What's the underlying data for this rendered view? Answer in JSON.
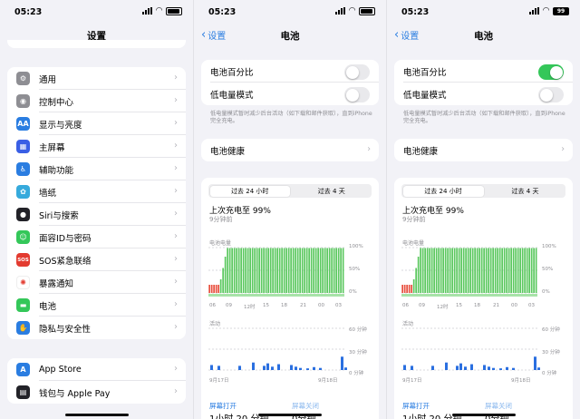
{
  "screens": [
    {
      "time": "05:23",
      "title": "设置",
      "items": [
        {
          "label": "通用",
          "icon": "gear-icon",
          "color": "#8e8e93",
          "glyph": "⚙"
        },
        {
          "label": "控制中心",
          "icon": "control-center-icon",
          "color": "#8e8e93",
          "glyph": "◉"
        },
        {
          "label": "显示与亮度",
          "icon": "display-brightness-icon",
          "color": "#2a7de1",
          "glyph": "AA"
        },
        {
          "label": "主屏幕",
          "icon": "home-screen-icon",
          "color": "#3a5fe5",
          "glyph": "▦"
        },
        {
          "label": "辅助功能",
          "icon": "accessibility-icon",
          "color": "#2a7de1",
          "glyph": "♿"
        },
        {
          "label": "墙纸",
          "icon": "wallpaper-icon",
          "color": "#36aadc",
          "glyph": "✿"
        },
        {
          "label": "Siri与搜索",
          "icon": "siri-icon",
          "color": "#222228",
          "glyph": "●"
        },
        {
          "label": "面容ID与密码",
          "icon": "face-id-icon",
          "color": "#34c759",
          "glyph": "☺"
        },
        {
          "label": "SOS紧急联络",
          "icon": "sos-icon",
          "color": "#e33b30",
          "glyph": "SOS"
        },
        {
          "label": "暴露通知",
          "icon": "exposure-notification-icon",
          "color": "#ffffff",
          "glyph": "✺"
        },
        {
          "label": "电池",
          "icon": "battery-icon",
          "color": "#34c759",
          "glyph": "▬"
        },
        {
          "label": "隐私与安全性",
          "icon": "privacy-hand-icon",
          "color": "#2a7de1",
          "glyph": "✋"
        }
      ],
      "items2": [
        {
          "label": "App Store",
          "icon": "app-store-icon",
          "color": "#2a7de1",
          "glyph": "A"
        },
        {
          "label": "钱包与 Apple Pay",
          "icon": "wallet-icon",
          "color": "#222228",
          "glyph": "▤"
        }
      ]
    },
    {
      "time": "05:23",
      "back": "设置",
      "title": "电池",
      "battery_percentage": "电池百分比",
      "low_power": "低电量模式",
      "percentage_on": false,
      "note": "低电量模式暂时减少后台活动（如下载和邮件获取），直到iPhone完全充电。",
      "battery_health": "电池健康",
      "tab_24h": "过去 24 小时",
      "tab_10d": "过去 4 天",
      "last_charge": "上次充电至 99%",
      "last_charge_ago": "9分钟前",
      "level_label": "电池电量",
      "activity_label": "活动",
      "level_ticks": [
        "100%",
        "50%",
        "0%"
      ],
      "activity_ticks": [
        "60 分钟",
        "30 分钟",
        "0 分钟"
      ],
      "x_ticks": [
        "06",
        "09",
        "12时",
        "15",
        "18",
        "21",
        "00",
        "03"
      ],
      "x_dates": [
        "9月17日",
        "9月18日"
      ],
      "screen_on": "屏幕打开",
      "screen_off": "屏幕关闭",
      "screen_on_value": "1小时 20 分钟",
      "screen_off_value": "0分钟"
    },
    {
      "time": "05:23",
      "back": "设置",
      "title": "电池",
      "battery_level": "99",
      "battery_percentage": "电池百分比",
      "low_power": "低电量模式",
      "percentage_on": true,
      "note": "低电量模式暂时减少后台活动（如下载和邮件获取），直到iPhone完全充电。",
      "battery_health": "电池健康",
      "tab_24h": "过去 24 小时",
      "tab_10d": "过去 4 天",
      "last_charge": "上次充电至 99%",
      "last_charge_ago": "9分钟前",
      "level_label": "电池电量",
      "activity_label": "活动",
      "level_ticks": [
        "100%",
        "50%",
        "0%"
      ],
      "activity_ticks": [
        "60 分钟",
        "30 分钟",
        "0 分钟"
      ],
      "x_ticks": [
        "06",
        "09",
        "12时",
        "15",
        "18",
        "21",
        "00",
        "03"
      ],
      "x_dates": [
        "9月17日",
        "9月18日"
      ],
      "screen_on": "屏幕打开",
      "screen_off": "屏幕关闭",
      "screen_on_value": "1小时 20 分钟",
      "screen_off_value": "0分钟"
    }
  ]
}
